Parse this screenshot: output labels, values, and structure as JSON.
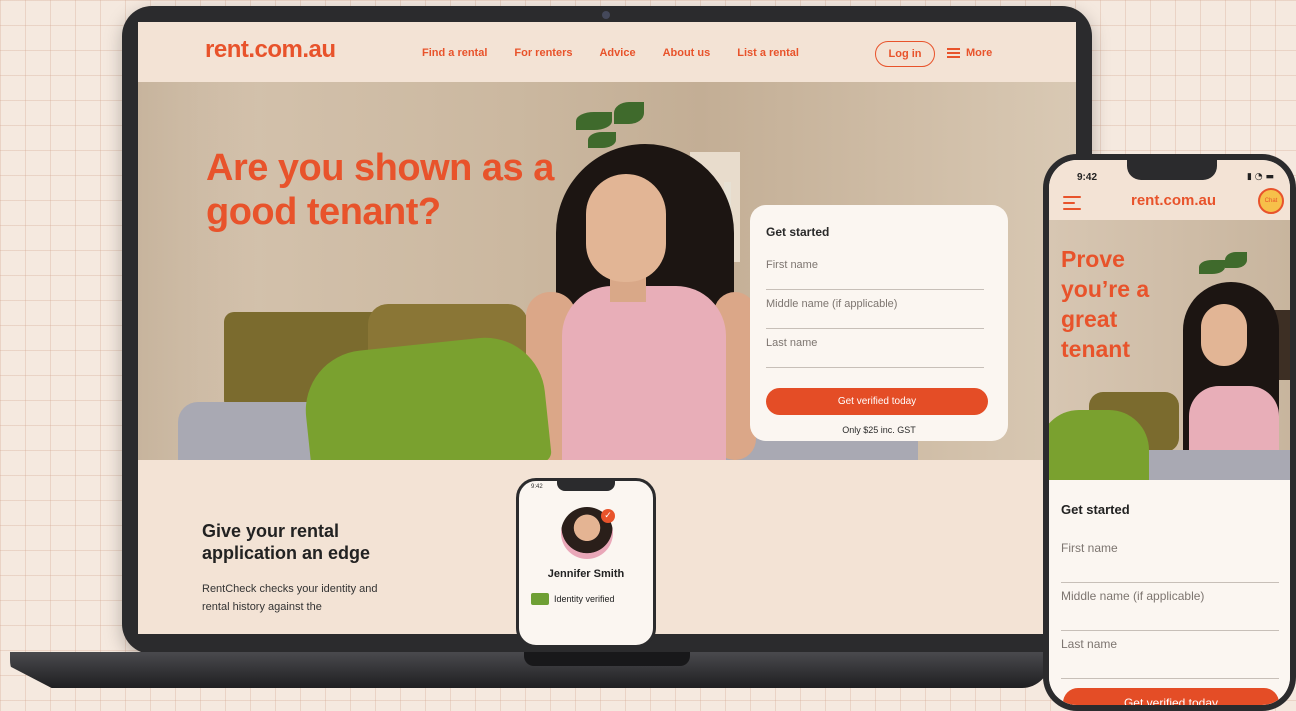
{
  "brand": {
    "logo_text": "rent.com.au",
    "primary_color": "#e8532b",
    "cta_color": "#e44d26",
    "background": "#f5e9df"
  },
  "desktop": {
    "nav": {
      "links": [
        "Find a rental",
        "For renters",
        "Advice",
        "About us",
        "List a rental"
      ],
      "login_label": "Log in",
      "more_label": "More"
    },
    "hero": {
      "headline": "Are you shown as a good tenant?"
    },
    "form": {
      "title": "Get started",
      "fields": [
        "First name",
        "Middle name (if applicable)",
        "Last name"
      ],
      "cta_label": "Get verified today",
      "note": "Only $25 inc. GST"
    },
    "section": {
      "title": "Give your rental application an edge",
      "body": "RentCheck checks your identity and rental history against the"
    },
    "mini_profile": {
      "name": "Jennifer Smith",
      "verified_label": "Identity verified",
      "time": "9:42"
    }
  },
  "mobile": {
    "status": {
      "time": "9:42",
      "icons": "▮ ◔ ▬"
    },
    "logo_text": "rent.com.au",
    "chat_label": "Chat",
    "headline": "Prove you’re a great tenant",
    "form": {
      "title": "Get started",
      "fields": [
        "First name",
        "Middle name (if applicable)",
        "Last name"
      ],
      "cta_label": "Get verified today"
    }
  }
}
